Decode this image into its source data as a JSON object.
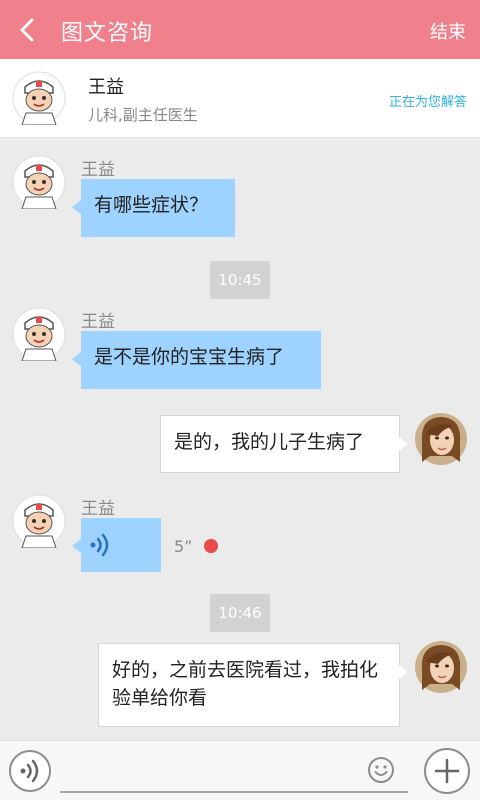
{
  "header": {
    "title": "图文咨询",
    "end_label": "结束",
    "back_icon": "chevron-left-icon"
  },
  "doctor": {
    "name": "王益",
    "title": "儿科,副主任医生",
    "status": "正在为您解答"
  },
  "messages": [
    {
      "sender": "王益",
      "type": "text",
      "text": "有哪些症状？"
    },
    {
      "type": "time",
      "text": "10:45"
    },
    {
      "sender": "王益",
      "type": "text",
      "text": "是不是你的宝宝生病了"
    },
    {
      "sender": "me",
      "type": "text",
      "text": "是的，我的儿子生病了"
    },
    {
      "sender": "王益",
      "type": "voice",
      "duration": "5”",
      "unread": true
    },
    {
      "type": "time",
      "text": "10:46"
    },
    {
      "sender": "me",
      "type": "text",
      "text": "好的，之前去医院看过，我拍化验单给你看"
    }
  ],
  "input": {
    "placeholder": "",
    "value": ""
  },
  "colors": {
    "header": "#f0808c",
    "doctor_bubble": "#9fd3ff",
    "status_text": "#2fb2e3",
    "unread_dot": "#ec4a4a"
  }
}
